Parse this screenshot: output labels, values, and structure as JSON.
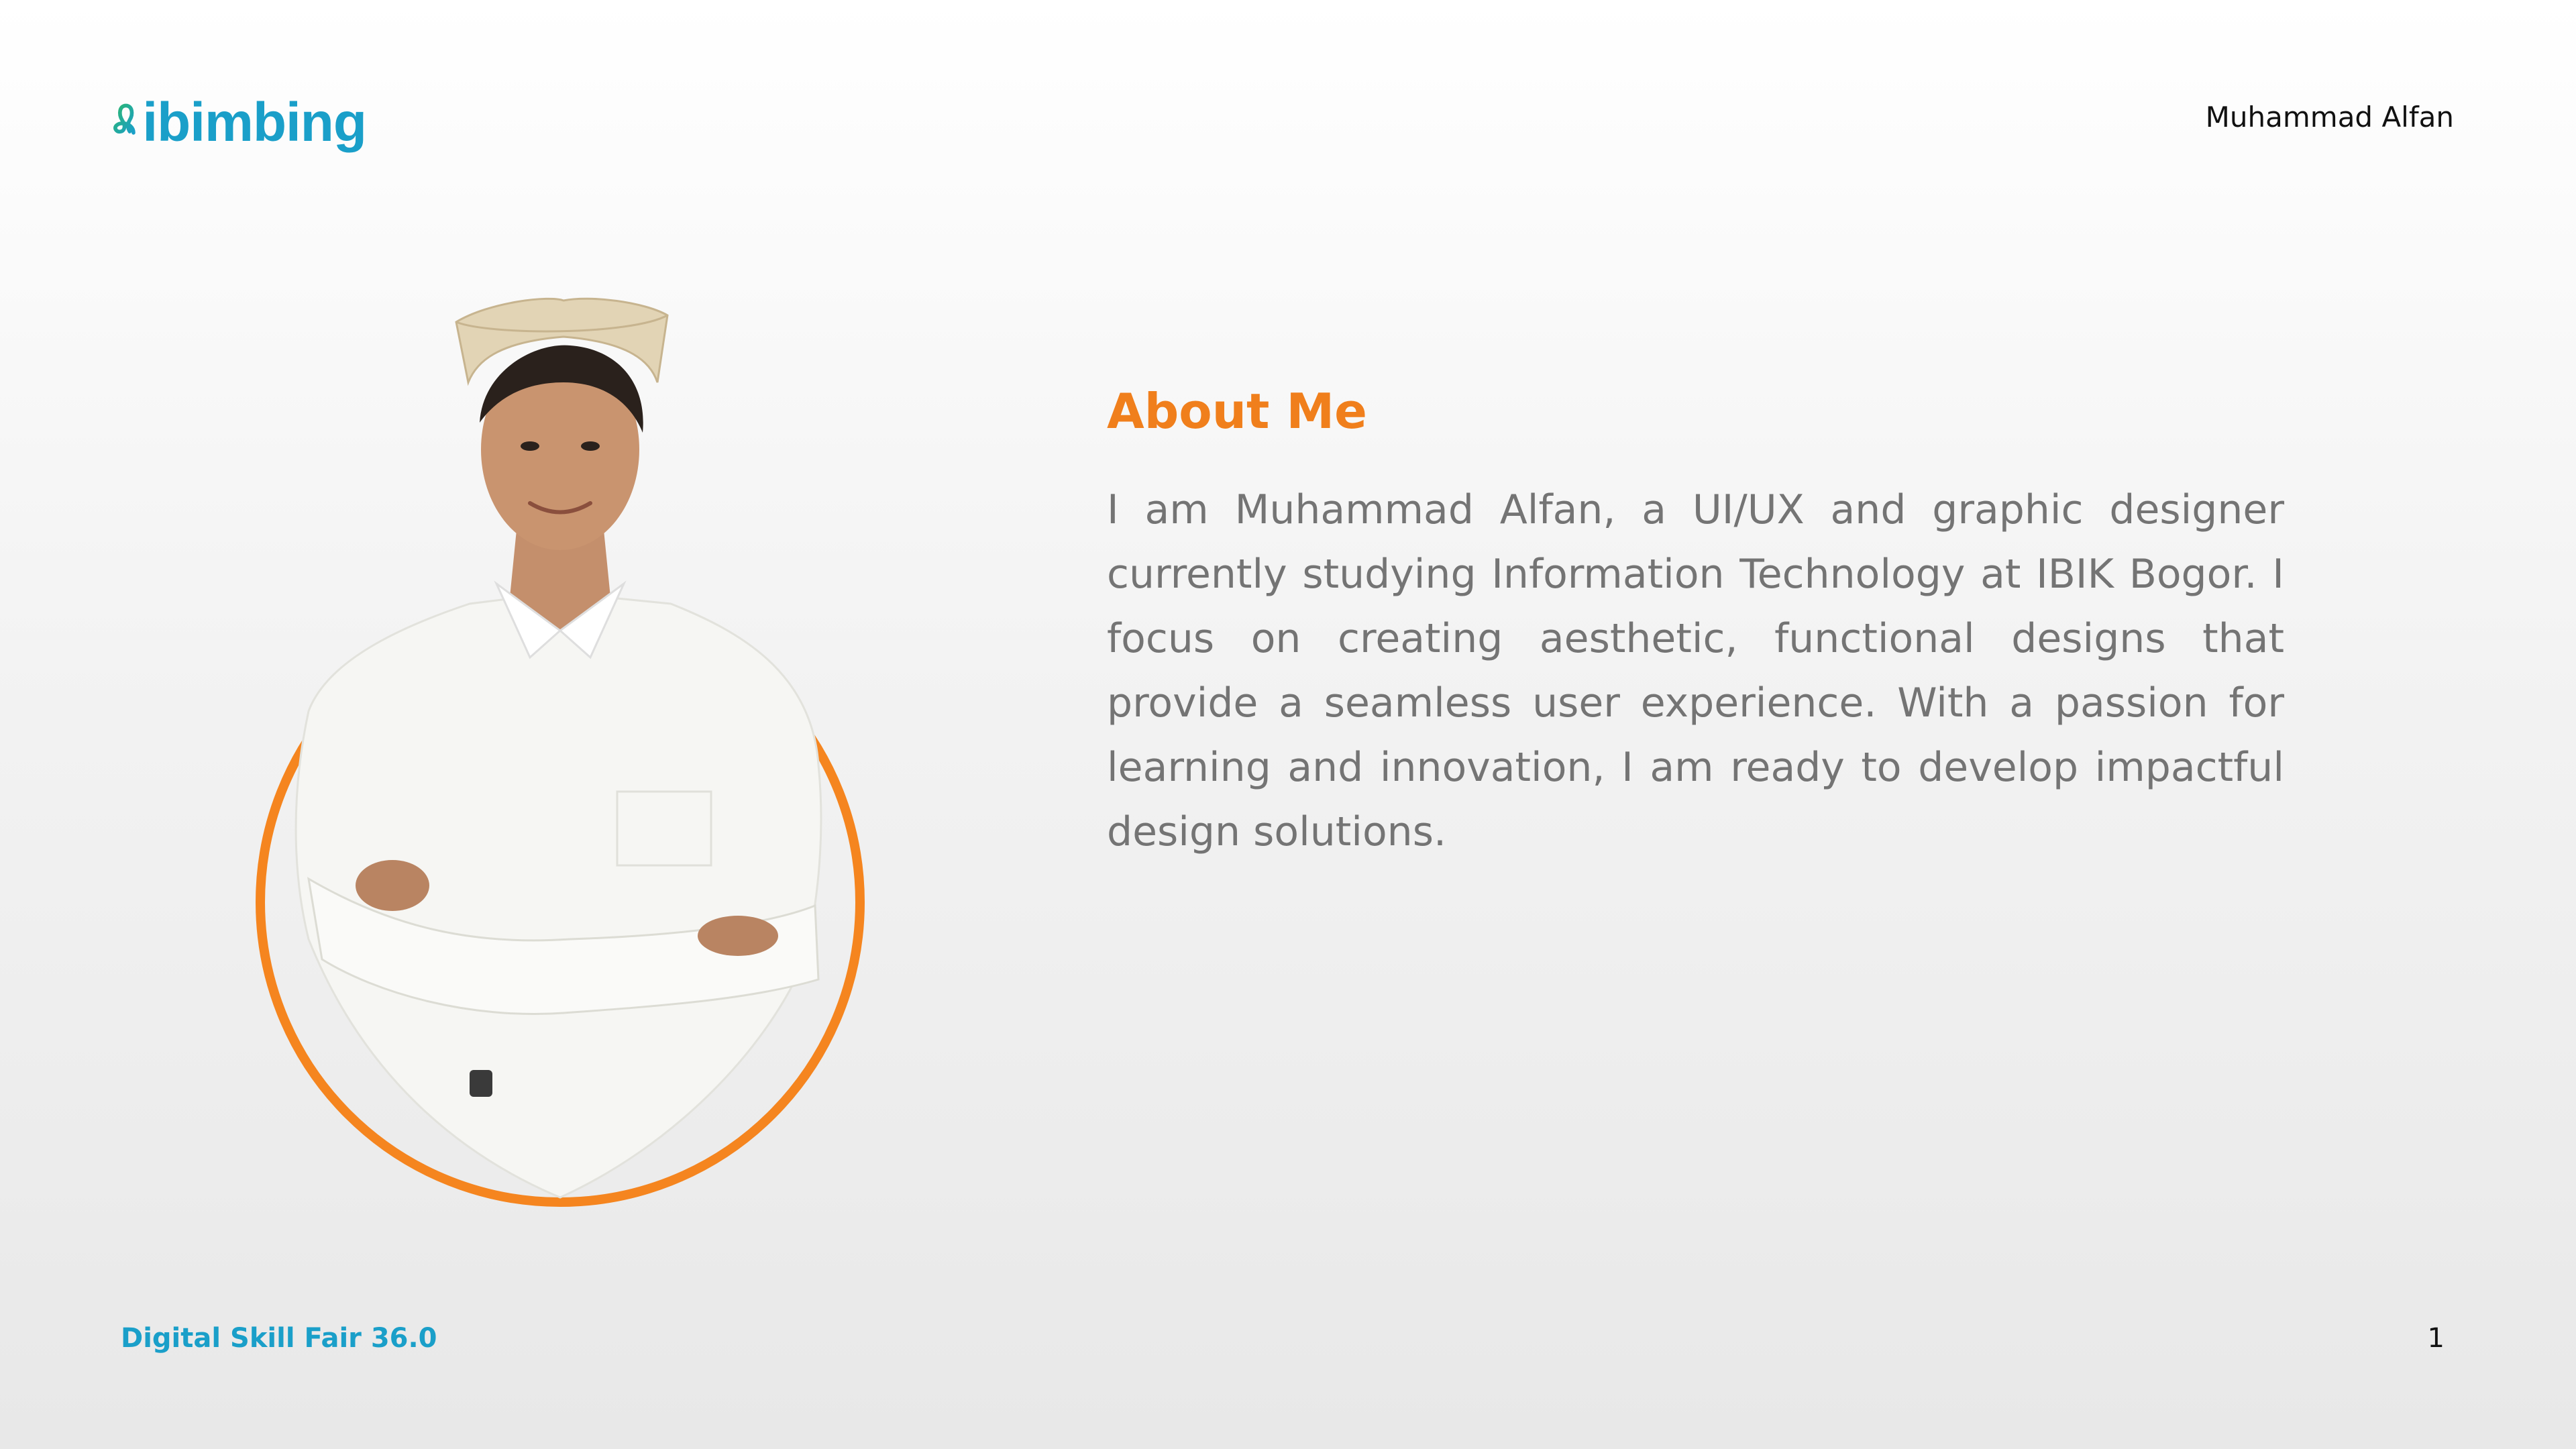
{
  "header": {
    "logo_text": "ibimbing",
    "author_name": "Muhammad Alfan"
  },
  "about": {
    "title": "About Me",
    "body": "I am Muhammad Alfan, a UI/UX and graphic designer currently studying Information Technology at IBIK Bogor. I focus on creating aesthetic, functional designs that provide a seamless user experience. With a passion for learning and innovation, I am ready to develop impactful design solutions."
  },
  "footer": {
    "event": "Digital Skill Fair 36.0",
    "page_number": "1"
  },
  "colors": {
    "brand_blue": "#1a9fc9",
    "brand_green": "#2bb673",
    "accent_orange": "#f07f1c",
    "body_text": "#747474"
  }
}
